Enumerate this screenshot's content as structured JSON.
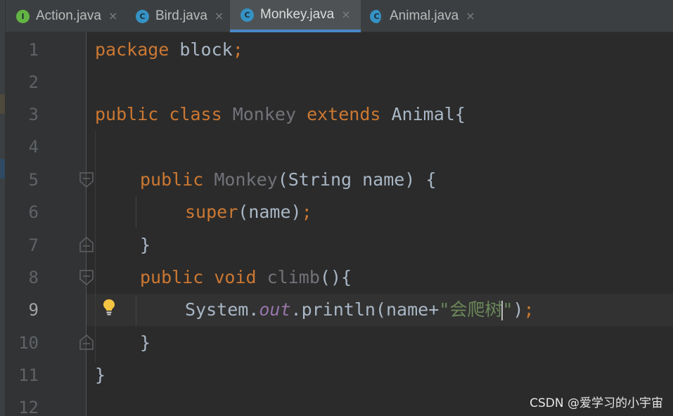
{
  "tabs": [
    {
      "label": "Action.java",
      "icon": "I",
      "icon_color": "#62b543",
      "active": false
    },
    {
      "label": "Bird.java",
      "icon": "C",
      "icon_color": "#3592c4",
      "active": false
    },
    {
      "label": "Monkey.java",
      "icon": "C",
      "icon_color": "#3592c4",
      "active": true
    },
    {
      "label": "Animal.java",
      "icon": "C",
      "icon_color": "#3592c4",
      "active": false
    }
  ],
  "tab_close_glyph": "×",
  "gutter": {
    "line_numbers": [
      "1",
      "2",
      "3",
      "4",
      "5",
      "6",
      "7",
      "8",
      "9",
      "10",
      "11",
      "12"
    ],
    "current_line": "9"
  },
  "code": {
    "l1": {
      "kw": "package",
      "rest": "block",
      "semi": ";"
    },
    "l3": {
      "kw1": "public",
      "kw2": "class",
      "name": "Monkey",
      "kw3": "extends",
      "parent": "Animal{"
    },
    "l5": {
      "kw": "public",
      "name": "Monkey",
      "open": "(String name) {"
    },
    "l6": {
      "kw": "super",
      "args": "(name)",
      "semi": ";"
    },
    "l7": {
      "text": "}"
    },
    "l8": {
      "kw1": "public",
      "kw2": "void",
      "name": "climb",
      "rest": "(){"
    },
    "l9": {
      "obj": "System.",
      "field": "out",
      "call": ".println(",
      "var": "name",
      "plus": "+",
      "str_open": "\"会爬树",
      "str_close": "\"",
      "close": ")",
      "semi": ";"
    },
    "l10": {
      "text": "}"
    },
    "l11": {
      "text": "}"
    }
  },
  "colors": {
    "keyword": "#cc7832",
    "plain": "#a9b7c6",
    "unused": "#72737a",
    "static_field": "#9876aa",
    "string": "#6a8759",
    "active_tab_underline": "#4a88c7"
  },
  "icons": {
    "fold_open": "fold-open-icon",
    "fold_close": "fold-close-icon",
    "bulb": "lightbulb-icon"
  },
  "watermark": "CSDN @爱学习的小宇宙"
}
